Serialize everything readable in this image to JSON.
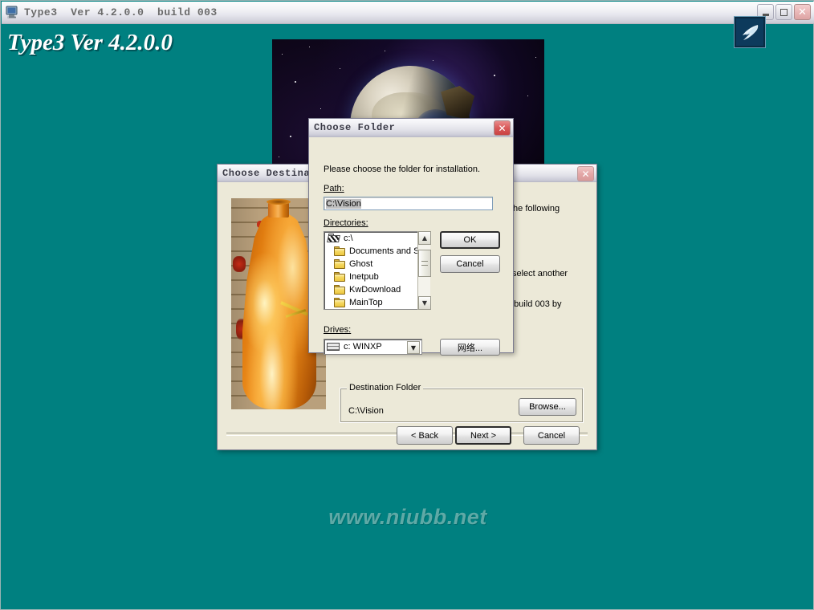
{
  "app": {
    "titlebar": {
      "icon": "computer-icon",
      "title": "Type3  Ver 4.2.0.0  build 003",
      "minimize_label": "–",
      "maximize_label": "□",
      "close_label": "✕"
    },
    "banner": "Type3 Ver 4.2.0.0",
    "logo": "bird-logo-icon",
    "background_color": "#008080",
    "watermark": "www.niubb.net"
  },
  "destination_dialog": {
    "title": "Choose Destina",
    "close_label": "✕",
    "artwork": "orange-vase-photo",
    "body_fragments": [
      "the following",
      "select another",
      "0 build 003 by"
    ],
    "group": {
      "label": "Destination Folder",
      "path_value": "C:\\Vision",
      "browse_label": "Browse..."
    },
    "buttons": {
      "back": "< Back",
      "next": "Next >",
      "cancel": "Cancel"
    }
  },
  "choose_folder_dialog": {
    "title": "Choose Folder",
    "close_label": "✕",
    "instruction": "Please choose the folder for installation.",
    "path": {
      "label": "Path:",
      "value": "C:\\Vision"
    },
    "directories": {
      "label": "Directories:",
      "items": [
        {
          "name": "c:\\",
          "icon": "open-drive-icon"
        },
        {
          "name": "Documents and Se",
          "icon": "folder-icon"
        },
        {
          "name": "Ghost",
          "icon": "folder-icon"
        },
        {
          "name": "Inetpub",
          "icon": "folder-icon"
        },
        {
          "name": "KwDownload",
          "icon": "folder-icon"
        },
        {
          "name": "MainTop",
          "icon": "folder-icon"
        }
      ],
      "scroll_up": "▲",
      "scroll_down": "▼"
    },
    "drives": {
      "label": "Drives:",
      "selected": "c: WINXP",
      "arrow": "▼"
    },
    "buttons": {
      "ok": "OK",
      "cancel": "Cancel",
      "network": "网络..."
    }
  }
}
